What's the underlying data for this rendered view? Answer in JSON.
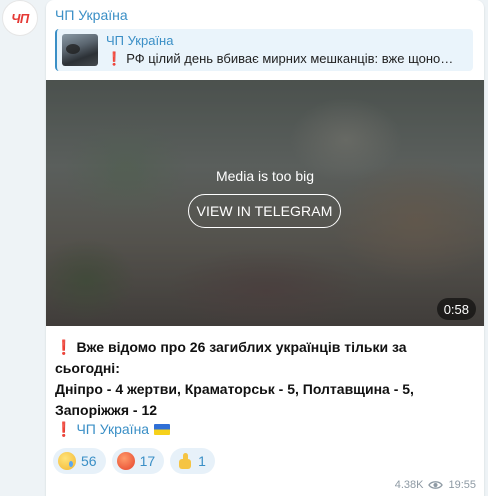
{
  "avatar": {
    "text": "ЧП",
    "color": "#e53935"
  },
  "message": {
    "channel_name": "ЧП Україна",
    "reply": {
      "author": "ЧП Україна",
      "text": "РФ цілий день вбиває мирних мешканців: вже щоно…"
    },
    "media": {
      "notice": "Media is too big",
      "button_label": "VIEW IN TELEGRAM",
      "duration": "0:58"
    },
    "body_lines": [
      "Вже відомо про 26 загиблих українців тільки за сьогодні:",
      "Дніпро - 4 жертви, Краматорськ - 5, Полтавщина - 5,",
      "Запоріжжя - 12"
    ],
    "signature": "ЧП Україна",
    "reactions": [
      {
        "emoji": "crying-face",
        "count": "56"
      },
      {
        "emoji": "enraged-face",
        "count": "17"
      },
      {
        "emoji": "thumbs-up",
        "count": "1"
      }
    ],
    "views": "4.38K",
    "time": "19:55"
  },
  "colors": {
    "accent": "#3a8fc6",
    "alert": "#e0202b",
    "background": "#eef3f6"
  }
}
